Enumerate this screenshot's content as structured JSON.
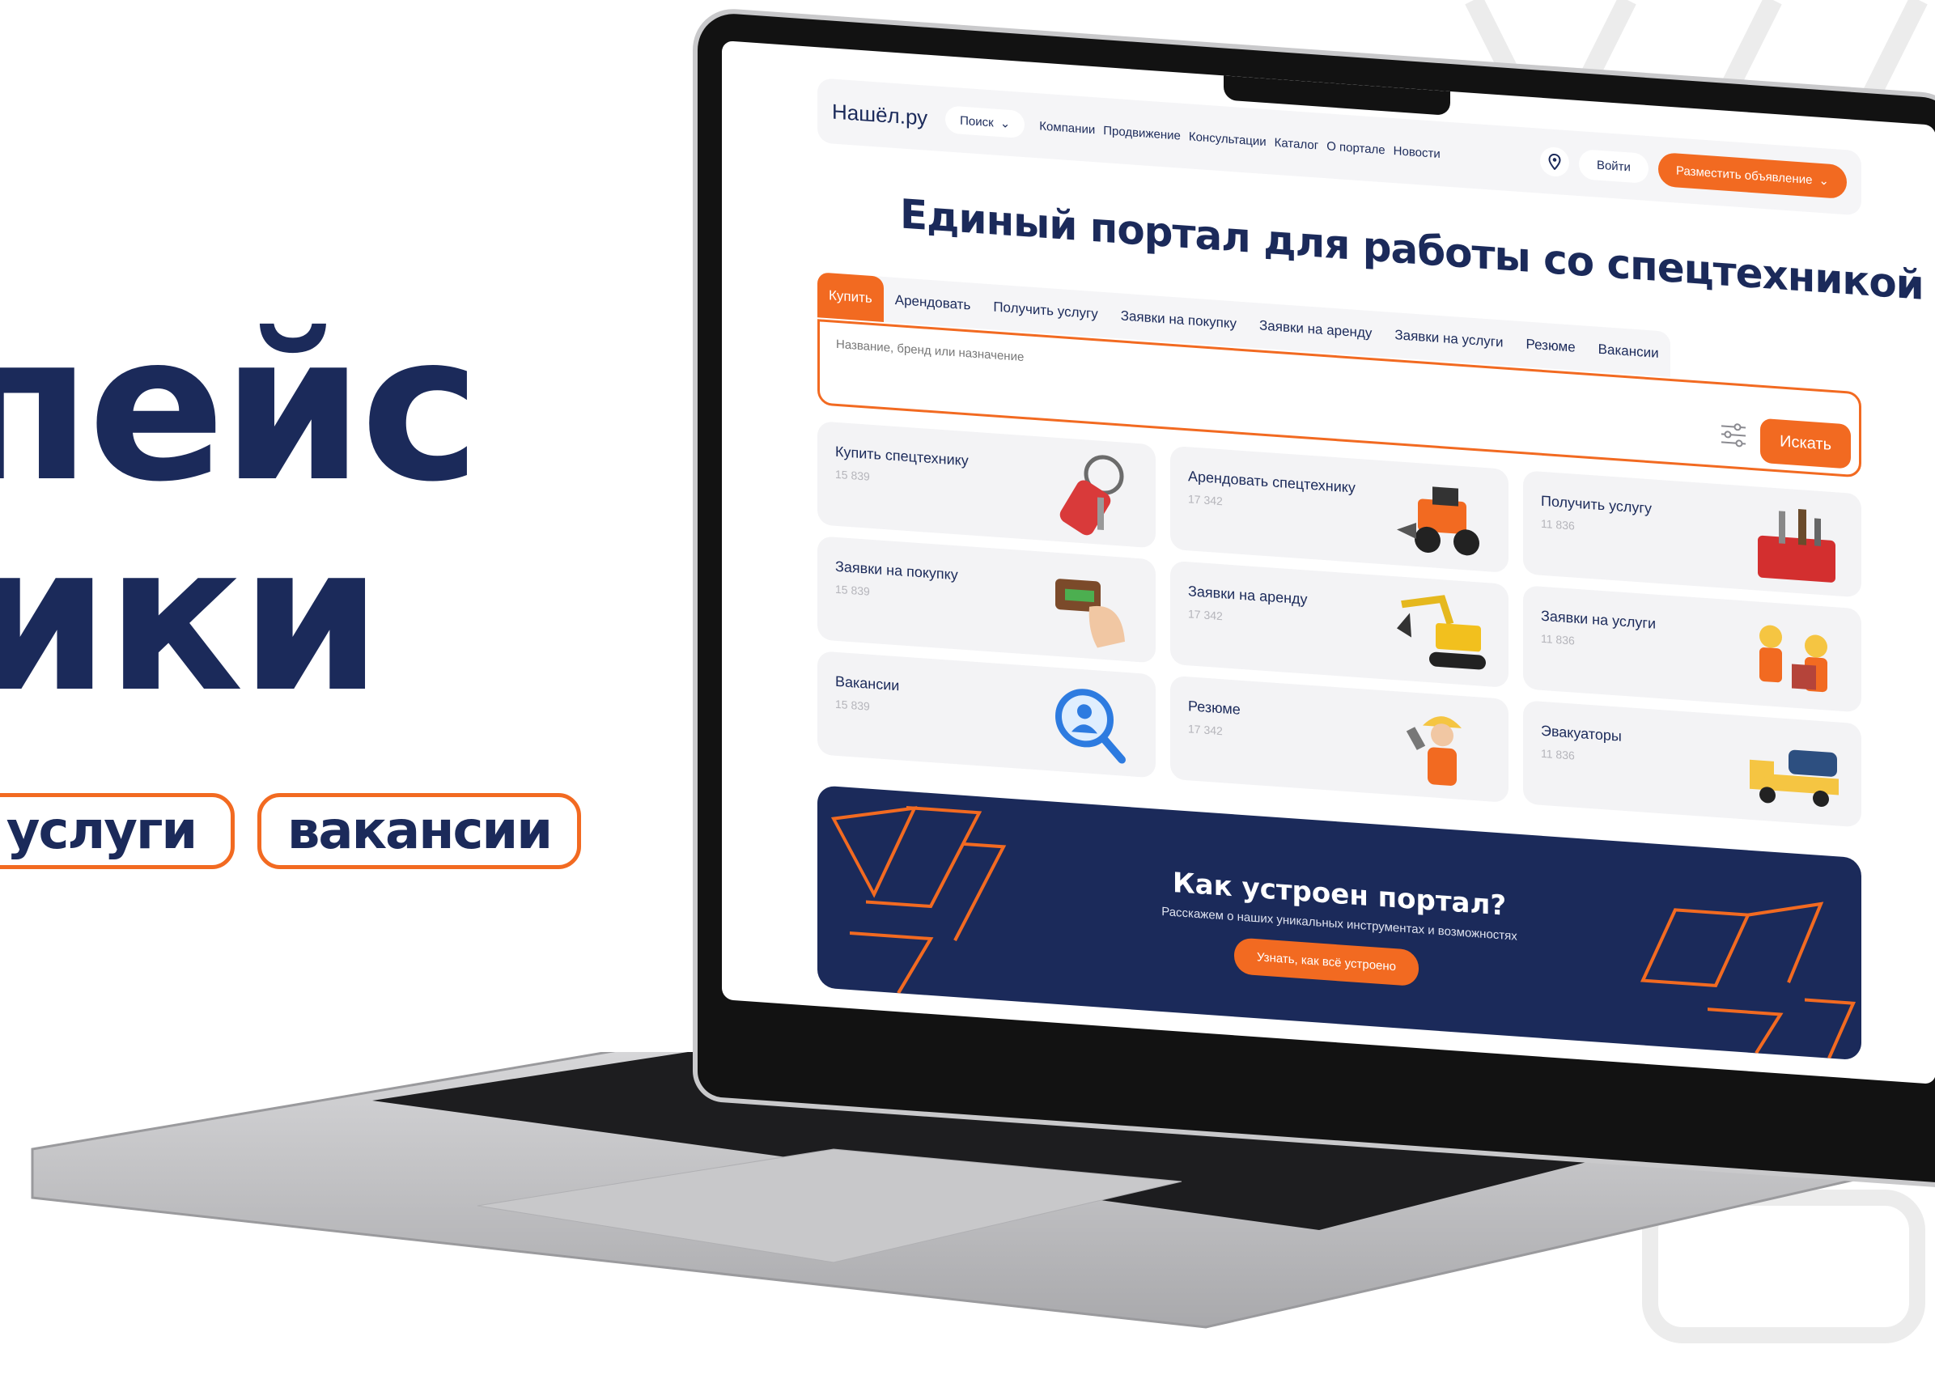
{
  "promo": {
    "line1": "пейс",
    "line2": "ики",
    "pill1": "услуги",
    "pill2": "вакансии"
  },
  "site": {
    "logo": "Нашёл",
    "logo_suffix": ".ру",
    "search_dropdown": "Поиск",
    "nav_links": [
      "Компании",
      "Продвижение",
      "Консультации",
      "Каталог",
      "О портале",
      "Новости"
    ],
    "login": "Войти",
    "post_ad": "Разместить объявление",
    "headline": "Единый портал для работы со спецтехникой",
    "tabs": [
      "Купить",
      "Арендовать",
      "Получить услугу",
      "Заявки на покупку",
      "Заявки на аренду",
      "Заявки на услуги",
      "Резюме",
      "Вакансии"
    ],
    "search_placeholder": "Название, бренд или назначение",
    "search_button": "Искать",
    "cards": [
      {
        "title": "Купить спецтехнику",
        "count": "15 839",
        "icon": "keys-icon"
      },
      {
        "title": "Арендовать спецтехнику",
        "count": "17 342",
        "icon": "excavator-loader-icon"
      },
      {
        "title": "Получить услугу",
        "count": "11 836",
        "icon": "toolbox-icon"
      },
      {
        "title": "Заявки на покупку",
        "count": "15 839",
        "icon": "wallet-hand-icon"
      },
      {
        "title": "Заявки на аренду",
        "count": "17 342",
        "icon": "excavator-icon"
      },
      {
        "title": "Заявки на услуги",
        "count": "11 836",
        "icon": "workers-icon"
      },
      {
        "title": "Вакансии",
        "count": "15 839",
        "icon": "user-search-icon"
      },
      {
        "title": "Резюме",
        "count": "17 342",
        "icon": "worker-icon"
      },
      {
        "title": "Эвакуаторы",
        "count": "11 836",
        "icon": "tow-truck-icon"
      }
    ],
    "banner": {
      "title": "Как устроен портал?",
      "subtitle": "Расскажем о наших уникальных инструментах и возможностях",
      "button": "Узнать, как всё устроено"
    }
  },
  "colors": {
    "accent": "#f26a21",
    "navy": "#1b2a5a"
  }
}
